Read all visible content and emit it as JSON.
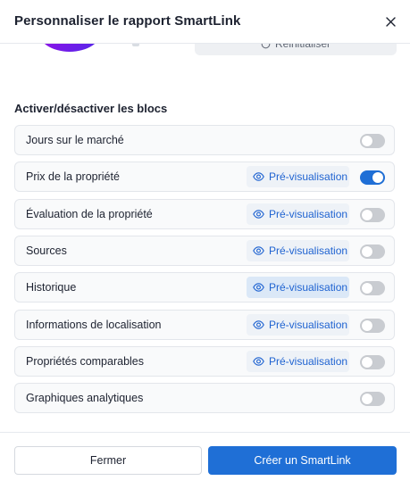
{
  "modal": {
    "title": "Personnaliser le rapport SmartLink",
    "reset_label": "Réinitialiser"
  },
  "blocks_section": {
    "title": "Activer/désactiver les blocs",
    "preview_label": "Pré-visualisation",
    "items": [
      {
        "label": "Jours sur le marché",
        "has_preview": false,
        "enabled": false
      },
      {
        "label": "Prix de la propriété",
        "has_preview": true,
        "enabled": true
      },
      {
        "label": "Évaluation de la propriété",
        "has_preview": true,
        "enabled": false
      },
      {
        "label": "Sources",
        "has_preview": true,
        "enabled": false
      },
      {
        "label": "Historique",
        "has_preview": true,
        "enabled": false,
        "hovered": true
      },
      {
        "label": "Informations de localisation",
        "has_preview": true,
        "enabled": false
      },
      {
        "label": "Propriétés comparables",
        "has_preview": true,
        "enabled": false
      },
      {
        "label": "Graphiques analytiques",
        "has_preview": false,
        "enabled": false
      }
    ]
  },
  "footer": {
    "close_label": "Fermer",
    "create_label": "Créer un SmartLink"
  },
  "colors": {
    "accent": "#1f6fd6",
    "preview_text": "#1f63d1",
    "toggle_off": "#c9ccd1"
  }
}
